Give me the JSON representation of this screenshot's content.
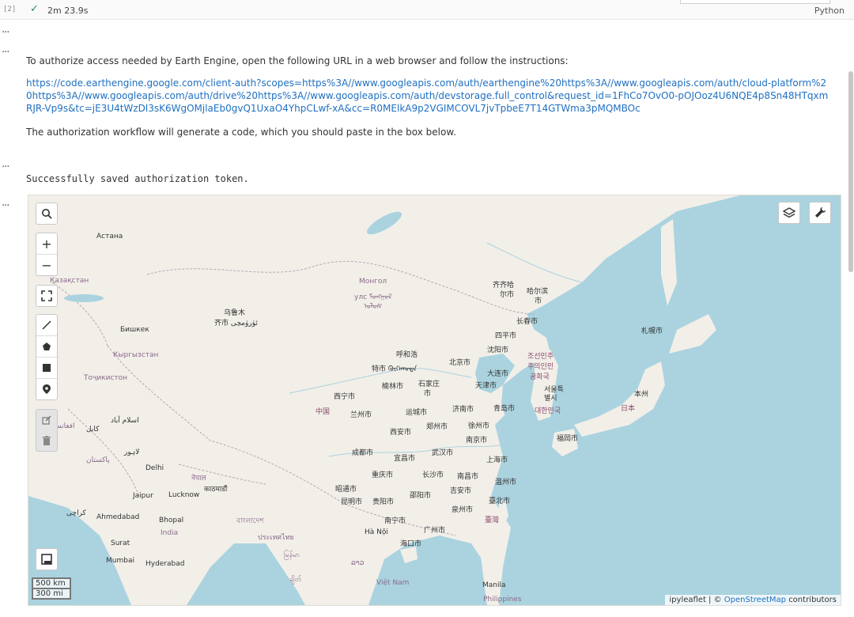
{
  "cell": {
    "execution_count": "[2]",
    "status_icon": "check-icon",
    "run_time": "2m 23.9s",
    "language": "Python"
  },
  "output": {
    "ellipsis": "...",
    "auth_intro": "To authorize access needed by Earth Engine, open the following URL in a web browser and follow the instructions:",
    "auth_url": "https://code.earthengine.google.com/client-auth?scopes=https%3A//www.googleapis.com/auth/earthengine%20https%3A//www.googleapis.com/auth/cloud-platform%20https%3A//www.googleapis.com/auth/drive%20https%3A//www.googleapis.com/auth/devstorage.full_control&request_id=1FhCo7OvO0-pOJOoz4U6NQE4p8Sn48HTqxmRJR-Vp9s&tc=jE3U4tWzDl3sK6WgOMjlaEb0gvQ1UxaO4YhpCLwf-xA&cc=R0MElkA9p2VGIMCOVL7jvTpbeE7T14GTWma3pMQMBOc",
    "auth_note": "The authorization workflow will generate a code, which you should paste in the box below.",
    "token_saved": "Successfully saved authorization token."
  },
  "map": {
    "controls": {
      "search": "search-icon",
      "zoom_in": "+",
      "zoom_out": "−",
      "layers": "layers-icon",
      "tools": "wrench-icon"
    },
    "scale": {
      "km": "500 km",
      "mi": "300 mi"
    },
    "attribution": {
      "prefix": "ipyleaflet | ©",
      "link": "OpenStreetMap",
      "suffix": "contributors"
    },
    "labels": {
      "astana": "Астана",
      "kazakhstan": "Қазақстан",
      "mongolia": "Монгол",
      "mongolia_trad": "улс ᠮᠣᠩᠭᠣᠯ",
      "mongolia_trad2": "ᠤᠯᠤᠰ",
      "urumqi": "乌鲁木",
      "urumqi2": "齐市 ئۈرۈمچى",
      "bishkek": "Бишкек",
      "kyrgyzstan": "Кыргызстан",
      "tochikiston": "Тоҷикистон",
      "afghanistan": "افغانستان",
      "islamabad": "اسلام آباد",
      "kabul": "کابل",
      "lahore": "لاہور",
      "pakistan": "پاکستان",
      "delhi": "Delhi",
      "jaipur": "Jaipur",
      "lucknow": "Lucknow",
      "karachi": "کراچی",
      "ahmedabad": "Ahmedabad",
      "bhopal": "Bhopal",
      "india": "India",
      "surat": "Surat",
      "mumbai": "Mumbai",
      "hyderabad": "Hyderabad",
      "kathmandu": "काठमाडौं",
      "nepal": "नेपाल",
      "bangladesh": "বাংলাদেশ",
      "qiqihar": "齐齐哈",
      "qiqihar2": "尔市",
      "harbin": "哈尔滨",
      "harbin2": "市",
      "changchun": "长春市",
      "siping": "四平市",
      "shenyang": "沈阳市",
      "hohhot": "呼和浩",
      "hohhot2": "特市 ᠬᠥᠬᠡᠬᠣᠲᠠ",
      "beijing": "北京市",
      "tianjin": "天津市",
      "dalian": "大连市",
      "yulin": "榆林市",
      "shijiazhuang": "石家庄",
      "shijiazhuang2": "市",
      "xining": "西宁市",
      "lanzhou": "兰州市",
      "china": "中国",
      "yuncheng": "运城市",
      "jinan": "济南市",
      "qingdao": "青岛市",
      "zhengzhou": "郑州市",
      "xuzhou": "徐州市",
      "xian": "西安市",
      "nanjing": "南京市",
      "chengdu": "成都市",
      "wuhan": "武汉市",
      "shanghai": "上海市",
      "yichang": "宜昌市",
      "chongqing": "重庆市",
      "changsha": "长沙市",
      "nanchang": "南昌市",
      "wenzhou": "温州市",
      "zhaotong": "昭通市",
      "guiyang": "贵阳市",
      "shaoyang": "邵阳市",
      "jian": "吉安市",
      "kunming": "昆明市",
      "taibei": "臺北市",
      "quanzhou": "泉州市",
      "taiwan": "臺灣",
      "nanning": "南宁市",
      "guangzhou": "广州市",
      "hanoi": "Hà Nội",
      "haikou": "海口市",
      "nkorea1": "조선민주",
      "nkorea2": "주의인민",
      "nkorea3": "공화국",
      "seoul": "서울특",
      "seoul2": "별시",
      "skorea": "대한민국",
      "sapporo": "札幌市",
      "honshu": "本州",
      "japan": "日本",
      "fukuoka": "福岡市",
      "thailand": "ประเทศไทย",
      "myanmar": "မြန်မာ",
      "laos": "ລາວ",
      "vietnam": "Việt Nam",
      "manila": "Manila",
      "philippines": "Philippines",
      "chittagong": "ချိတ်"
    }
  },
  "colors": {
    "land": "#f2efe9",
    "water": "#aad3df",
    "border": "#b6a6b6",
    "link": "#1f70c1"
  }
}
